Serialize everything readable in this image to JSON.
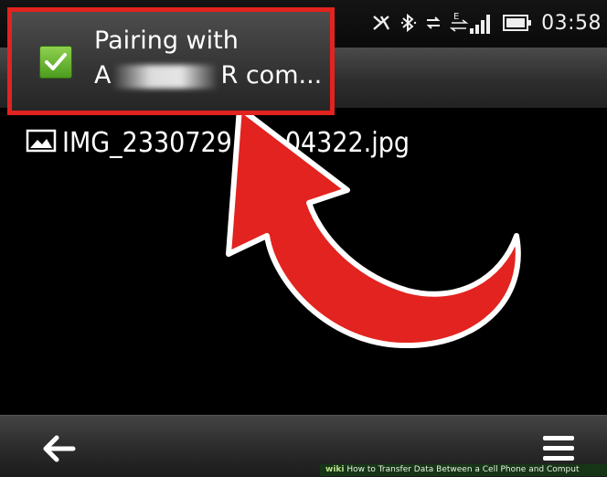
{
  "status_bar": {
    "time": "03:58",
    "icons": [
      "muted-icon",
      "bluetooth-icon",
      "data-transfer-icon",
      "edge-signal-icon",
      "battery-icon"
    ]
  },
  "notification": {
    "icon": "checkmark-icon",
    "line1": "Pairing with",
    "line2_prefix": "A",
    "line2_suffix": "R com...",
    "highlight_color": "#e2231f"
  },
  "file": {
    "icon": "image-icon",
    "name_start": "IMG_2330729",
    "name_end": "04322.jpg"
  },
  "annotation": {
    "arrow_color": "#e2231f"
  },
  "toolbar": {
    "back_icon": "back-arrow-icon",
    "menu_icon": "menu-icon"
  },
  "watermark": {
    "brand": "wiki",
    "text": "How to Transfer Data Between a Cell Phone and Comput"
  }
}
